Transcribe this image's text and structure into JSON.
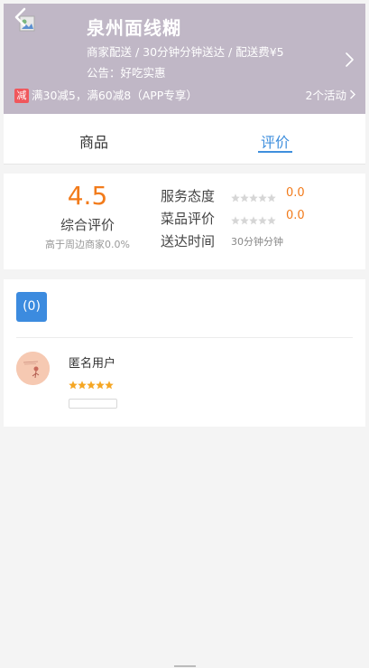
{
  "header": {
    "shop_name": "泉州面线糊",
    "meta": "商家配送 / 30分钟分钟送达 / 配送费¥5",
    "notice": "公告：好吃实惠",
    "promo_badge": "减",
    "promo_text": "满30减5，满60减8（APP专享）",
    "promo_more": "2个活动",
    "background_color": "#c0b7c6"
  },
  "tabs": [
    {
      "label": "商品",
      "active": false
    },
    {
      "label": "评价",
      "active": true
    }
  ],
  "score": {
    "value": "4.5",
    "label": "综合评价",
    "sub": "高于周边商家0.0%",
    "metrics": [
      {
        "label": "服务态度",
        "value": "0.0",
        "stars": 0
      },
      {
        "label": "菜品评价",
        "value": "0.0",
        "stars": 0
      }
    ],
    "delivery": {
      "label": "送达时间",
      "value": "30分钟分钟"
    }
  },
  "reviews": {
    "count_label": "(0)",
    "items": [
      {
        "user": "匿名用户",
        "stars": 5
      }
    ]
  },
  "colors": {
    "accent": "#3f8fdd",
    "score": "#f27b1b",
    "star": "#f5a623",
    "star_empty": "#d6d6d6",
    "promo": "#f0575c"
  },
  "icons": {
    "back": "chevron-left-icon",
    "more": "chevron-right-icon",
    "star": "star-icon"
  }
}
